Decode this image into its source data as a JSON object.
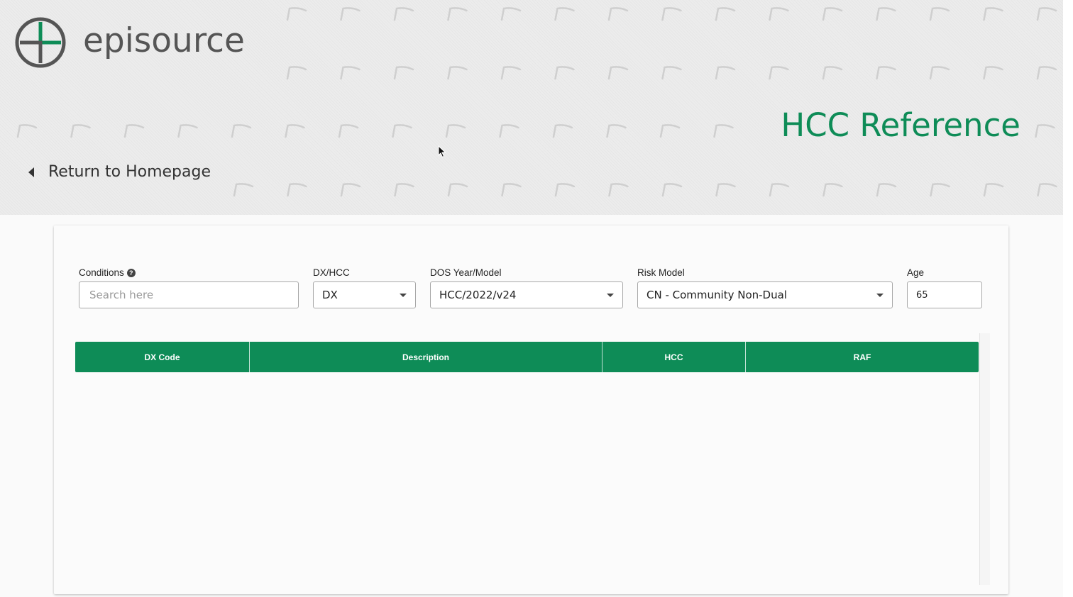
{
  "header": {
    "brand": "episource",
    "page_title": "HCC Reference",
    "back_link": "Return to Homepage"
  },
  "colors": {
    "accent": "#0e8c57",
    "text": "#222222",
    "brand_text": "#555555"
  },
  "filters": {
    "conditions": {
      "label": "Conditions",
      "placeholder": "Search here",
      "value": ""
    },
    "dx_hcc": {
      "label": "DX/HCC",
      "value": "DX"
    },
    "dos_year_model": {
      "label": "DOS Year/Model",
      "value": "HCC/2022/v24"
    },
    "risk_model": {
      "label": "Risk Model",
      "value": "CN - Community Non-Dual"
    },
    "age": {
      "label": "Age",
      "value": "65"
    }
  },
  "table": {
    "columns": [
      "DX Code",
      "Description",
      "HCC",
      "RAF"
    ],
    "rows": []
  },
  "icons": {
    "logo": "episource-logo-icon",
    "help": "question-circle-icon",
    "back": "caret-left-icon",
    "dropdown": "chevron-down-icon"
  }
}
